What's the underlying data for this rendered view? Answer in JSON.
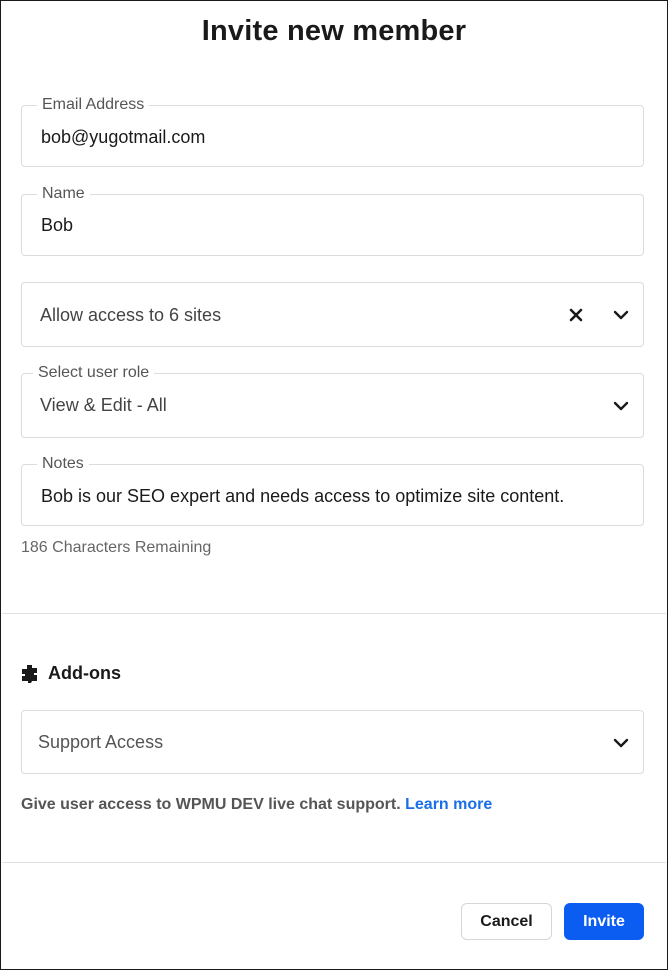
{
  "dialog": {
    "title": "Invite new member"
  },
  "email": {
    "label": "Email Address",
    "value": "bob@yugotmail.com"
  },
  "name": {
    "label": "Name",
    "value": "Bob"
  },
  "sites": {
    "value": "Allow access to 6 sites"
  },
  "role": {
    "label": "Select user role",
    "value": "View & Edit - All"
  },
  "notes": {
    "label": "Notes",
    "value": "Bob is our SEO expert and needs access to optimize site content.",
    "remaining": "186 Characters Remaining"
  },
  "addons": {
    "heading": "Add-ons",
    "support_select": "Support Access",
    "note": "Give user access to WPMU DEV live chat support.",
    "link": "Learn more"
  },
  "actions": {
    "cancel": "Cancel",
    "invite": "Invite"
  },
  "colors": {
    "primary": "#0b5cf0",
    "link": "#1a6fe8",
    "border": "#dcdcdc"
  },
  "icons": {
    "chevron": "chevron-down-icon",
    "clear": "close-icon",
    "addon": "puzzle-icon"
  }
}
